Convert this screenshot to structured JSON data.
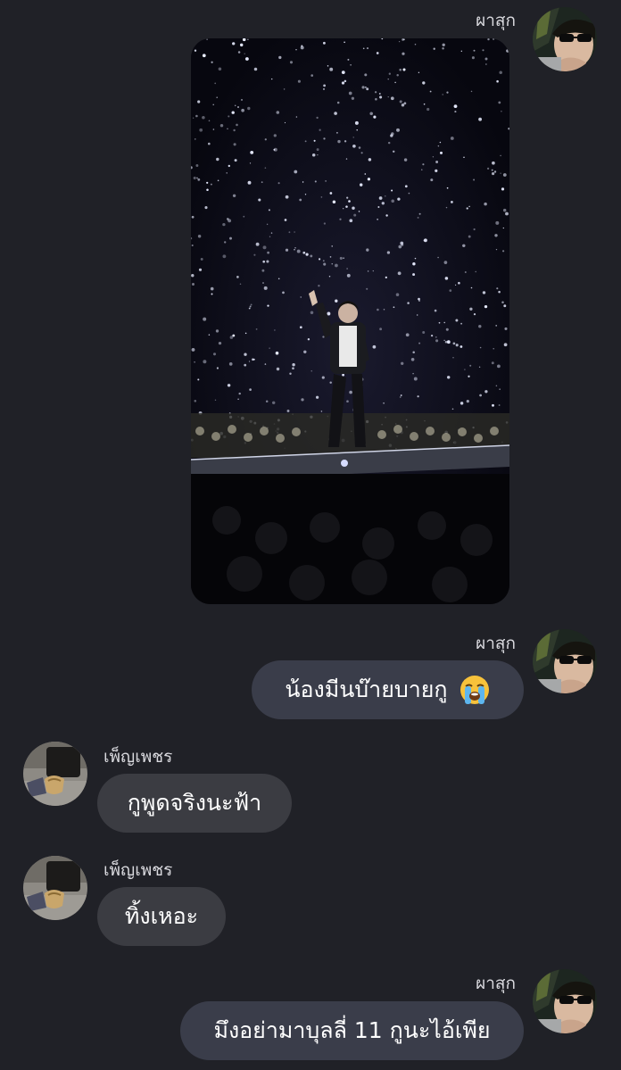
{
  "messages": [
    {
      "sender": "ผาสุก",
      "side": "right",
      "type": "image",
      "image_alt": "concert stage photo"
    },
    {
      "sender": "ผาสุก",
      "side": "right",
      "type": "text",
      "text": "น้องมีนบ๊ายบายกู",
      "emoji": "loudly-crying-face-icon"
    },
    {
      "sender": "เพ็ญเพชร",
      "side": "left",
      "type": "text",
      "text": "กูพูดจริงนะฟ้า"
    },
    {
      "sender": "เพ็ญเพชร",
      "side": "left",
      "type": "text",
      "text": "ทิ้งเหอะ"
    },
    {
      "sender": "ผาสุก",
      "side": "right",
      "type": "text",
      "text": "มึงอย่ามาบุลลี่ 11 กูนะไอ้เพีย"
    }
  ],
  "colors": {
    "background": "#202127",
    "bubble_right": "#3a3d4a",
    "bubble_left": "#3b3c42",
    "name_text": "#d9d9de"
  }
}
